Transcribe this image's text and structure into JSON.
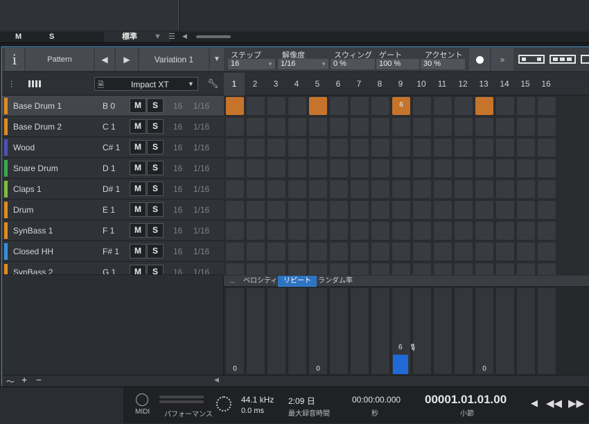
{
  "top": {
    "mute_label": "M",
    "solo_label": "S",
    "preset_label": "標準"
  },
  "toolbar": {
    "info_icon": "i",
    "pattern_label": "Pattern",
    "variation_label": "Variation 1",
    "step_label": "ステップ",
    "step_value": "16",
    "resolution_label": "解像度",
    "resolution_value": "1/16",
    "swing_label": "スウィング",
    "swing_value": "0 %",
    "gate_label": "ゲート",
    "gate_value": "100 %",
    "accent_label": "アクセント",
    "accent_value": "30 %"
  },
  "instrument": {
    "name": "Impact XT"
  },
  "steps": [
    "1",
    "2",
    "3",
    "4",
    "5",
    "6",
    "7",
    "8",
    "9",
    "10",
    "11",
    "12",
    "13",
    "14",
    "15",
    "16"
  ],
  "rows": [
    {
      "name": "Base Drum 1",
      "note": "B 0",
      "mute": "M",
      "solo": "S",
      "steps": "16",
      "res": "1/16",
      "color": "#e38a1f"
    },
    {
      "name": "Base Drum 2",
      "note": "C 1",
      "mute": "M",
      "solo": "S",
      "steps": "16",
      "res": "1/16",
      "color": "#e38a1f"
    },
    {
      "name": "Wood",
      "note": "C# 1",
      "mute": "M",
      "solo": "S",
      "steps": "16",
      "res": "1/16",
      "color": "#4e4fb8"
    },
    {
      "name": "Snare Drum",
      "note": "D 1",
      "mute": "M",
      "solo": "S",
      "steps": "16",
      "res": "1/16",
      "color": "#3fa84b"
    },
    {
      "name": "Claps 1",
      "note": "D# 1",
      "mute": "M",
      "solo": "S",
      "steps": "16",
      "res": "1/16",
      "color": "#7fbf3f"
    },
    {
      "name": "Drum",
      "note": "E 1",
      "mute": "M",
      "solo": "S",
      "steps": "16",
      "res": "1/16",
      "color": "#e38a1f"
    },
    {
      "name": "SynBass 1",
      "note": "F 1",
      "mute": "M",
      "solo": "S",
      "steps": "16",
      "res": "1/16",
      "color": "#e38a1f"
    },
    {
      "name": "Closed HH",
      "note": "F# 1",
      "mute": "M",
      "solo": "S",
      "steps": "16",
      "res": "1/16",
      "color": "#3a8fe0"
    },
    {
      "name": "SynBass 2",
      "note": "G 1",
      "mute": "M",
      "solo": "S",
      "steps": "16",
      "res": "1/16",
      "color": "#e38a1f"
    }
  ],
  "active_steps": [
    {
      "row": 0,
      "step": 1,
      "label": ""
    },
    {
      "row": 0,
      "step": 5,
      "label": ""
    },
    {
      "row": 0,
      "step": 9,
      "label": "6"
    },
    {
      "row": 0,
      "step": 13,
      "label": ""
    }
  ],
  "lane_tabs": {
    "dots": "...",
    "velocity": "ベロシティ",
    "repeat": "リピート",
    "random": "ランダム率"
  },
  "repeat_lane": {
    "labels": [
      {
        "step": 1,
        "text": "0"
      },
      {
        "step": 5,
        "text": "0"
      },
      {
        "step": 13,
        "text": "0"
      }
    ],
    "bar": {
      "step": 9,
      "value": 6,
      "max": 16,
      "label": "6"
    }
  },
  "status": {
    "midi": "MIDI",
    "performance": "パフォーマンス",
    "sample_rate": "44.1 kHz",
    "latency": "0.0 ms",
    "record_time": "2:09 日",
    "record_time_label": "最大録音時間",
    "seconds": "00:00:00.000",
    "seconds_label": "秒",
    "bars": "00001.01.01.00",
    "bars_label": "小節"
  },
  "colors": {
    "accent": "#3a92c8",
    "step_on": "#c6742c",
    "repeat_bar": "#1f6ad6"
  }
}
